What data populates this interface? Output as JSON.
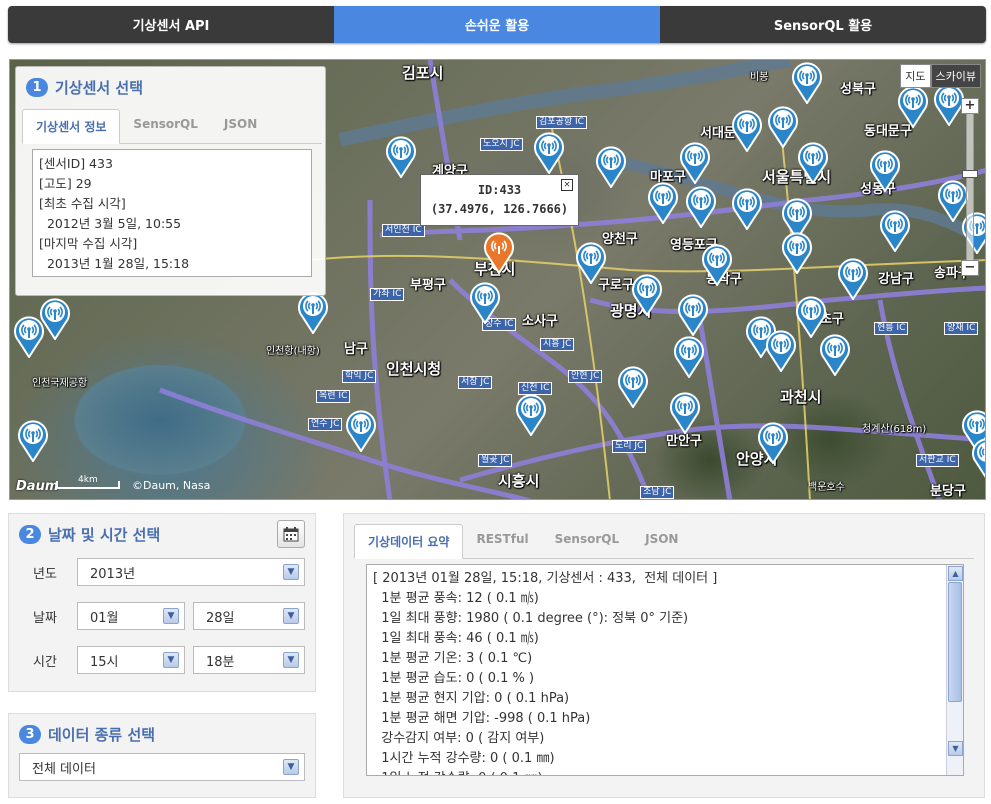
{
  "nav": {
    "tabs": [
      "기상센서 API",
      "손쉬운 활용",
      "SensorQL 활용"
    ],
    "active": 1
  },
  "map": {
    "types": [
      "지도",
      "스카이뷰"
    ],
    "popup": {
      "id_line": "ID:433",
      "coord_line": "(37.4976, 126.7666)"
    },
    "scale_label": "4km",
    "copyright": "©Daum, Nasa",
    "logo": "Daum",
    "labels": [
      "김포시",
      "계양구",
      "서대문구",
      "마포구",
      "성북구",
      "동대문구",
      "서울특별시",
      "성동구",
      "양천구",
      "영등포구",
      "부평구",
      "부천시",
      "구로구",
      "동작구",
      "광명시",
      "강남구",
      "송파구",
      "소사구",
      "서초구",
      "인천시청",
      "남구",
      "과천시",
      "안양시",
      "만안구",
      "시흥시",
      "분당구",
      "인천국제공항",
      "인천항(내항)",
      "청계산(618m)",
      "비봉",
      "백운호수"
    ],
    "ic_labels": [
      "김포공항 IC",
      "노오지 JC",
      "서인천 IC",
      "가좌 IC",
      "장수 IC",
      "시흥 JC",
      "안현 JC",
      "서창 JC",
      "신천 IC",
      "도리 JC",
      "조남 JC",
      "판교 IC",
      "양재 IC",
      "현릉 IC",
      "학익 JC",
      "옥련 IC",
      "연수 JC",
      "월곶 JC",
      "판교 IC",
      "서판교 IC"
    ]
  },
  "sensor_panel": {
    "number": "1",
    "title": "기상센서 선택",
    "tabs": [
      "기상센서 정보",
      "SensorQL",
      "JSON"
    ],
    "active_tab": 0,
    "info_text": "[센서ID] 433\n[고도] 29\n[최초 수집 시각]\n  2012년 3월 5일, 10:55\n[마지막 수집 시각]\n  2013년 1월 28일, 15:18"
  },
  "date_panel": {
    "number": "2",
    "title": "날짜 및 시간 선택",
    "calendar_icon": "calendar-icon",
    "year_label": "년도",
    "year_value": "2013년",
    "date_label": "날짜",
    "month_value": "01월",
    "day_value": "28일",
    "time_label": "시간",
    "hour_value": "15시",
    "minute_value": "18분"
  },
  "type_panel": {
    "number": "3",
    "title": "데이터 종류 선택",
    "selected": "전체 데이터"
  },
  "data_panel": {
    "tabs": [
      "기상데이터 요약",
      "RESTful",
      "SensorQL",
      "JSON"
    ],
    "active_tab": 0,
    "lines": [
      "[ 2013년 01월 28일, 15:18, 기상센서 : 433,  전체 데이터 ]",
      "  1분 평균 풍속: 12 ( 0.1 ㎧)",
      "  1일 최대 풍향: 1980 ( 0.1 degree (°): 정북 0° 기준)",
      "  1일 최대 풍속: 46 ( 0.1 ㎧)",
      "  1분 평균 기온: 3 ( 0.1 ℃)",
      "  1분 평균 습도: 0 ( 0.1 % )",
      "  1분 평균 현지 기압: 0 ( 0.1 hPa)",
      "  1분 평균 해면 기압: -998 ( 0.1 hPa)",
      "  강수감지 여부: 0 ( 감지 여부)",
      "  1시간 누적 강수량: 0 ( 0.1 ㎜)",
      "  1일 누적 강수량: 0 ( 0.1 ㎜)"
    ]
  },
  "colors": {
    "accent": "#4a87e0",
    "marker": "#2a85c9",
    "active_marker": "#e8772b"
  }
}
